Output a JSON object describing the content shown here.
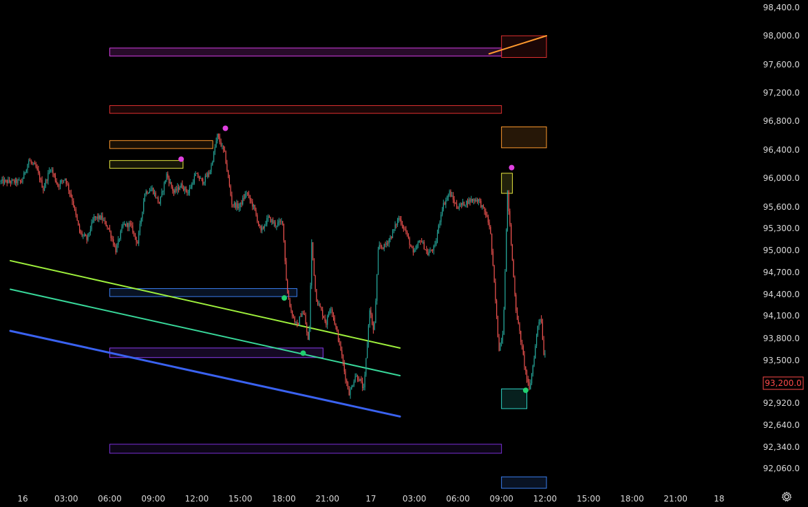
{
  "chart_data": {
    "type": "candlestick",
    "symbol": "",
    "title": "",
    "y_axis": {
      "ticks": [
        "98,400.0",
        "98,000.0",
        "97,600.0",
        "97,200.0",
        "96,800.0",
        "96,400.0",
        "96,000.0",
        "95,600.0",
        "95,300.0",
        "95,000.0",
        "94,700.0",
        "94,400.0",
        "94,100.0",
        "93,800.0",
        "93,500.0",
        "93,200.0",
        "92,920.0",
        "92,640.0",
        "92,340.0",
        "92,060.0"
      ],
      "ylim": [
        91800,
        98500
      ]
    },
    "x_axis": {
      "ticks": [
        "16",
        "03:00",
        "06:00",
        "09:00",
        "12:00",
        "15:00",
        "18:00",
        "21:00",
        "17",
        "03:00",
        "06:00",
        "09:00",
        "12:00",
        "15:00",
        "18:00",
        "21:00",
        "18"
      ]
    },
    "current_price": {
      "label": "93,200.0",
      "value": 93200,
      "color": "#ff4a4a"
    },
    "price_path": [
      [
        0.0,
        95950
      ],
      [
        0.5,
        96250
      ],
      [
        1.0,
        96150
      ],
      [
        1.5,
        95850
      ],
      [
        2.0,
        96150
      ],
      [
        2.5,
        95900
      ],
      [
        3.0,
        96000
      ],
      [
        3.5,
        95700
      ],
      [
        4.0,
        95250
      ],
      [
        4.5,
        95150
      ],
      [
        5.0,
        95450
      ],
      [
        5.5,
        95450
      ],
      [
        6.0,
        95300
      ],
      [
        6.5,
        95000
      ],
      [
        7.0,
        95350
      ],
      [
        7.5,
        95350
      ],
      [
        8.0,
        95100
      ],
      [
        8.5,
        95800
      ],
      [
        9.0,
        95850
      ],
      [
        9.5,
        95650
      ],
      [
        10.0,
        96050
      ],
      [
        10.5,
        95800
      ],
      [
        11.0,
        95900
      ],
      [
        11.5,
        95800
      ],
      [
        12.0,
        96050
      ],
      [
        12.5,
        95950
      ],
      [
        13.0,
        96100
      ],
      [
        13.5,
        96600
      ],
      [
        14.0,
        96350
      ],
      [
        14.5,
        95650
      ],
      [
        15.0,
        95600
      ],
      [
        15.5,
        95800
      ],
      [
        16.0,
        95600
      ],
      [
        16.5,
        95250
      ],
      [
        17.0,
        95450
      ],
      [
        17.5,
        95350
      ],
      [
        18.0,
        95400
      ],
      [
        18.3,
        94450
      ],
      [
        18.6,
        94150
      ],
      [
        19.0,
        93950
      ],
      [
        19.3,
        94150
      ],
      [
        19.5,
        94100
      ],
      [
        19.8,
        93700
      ],
      [
        20.0,
        95100
      ],
      [
        20.3,
        94350
      ],
      [
        20.6,
        94200
      ],
      [
        21.0,
        94000
      ],
      [
        21.3,
        94250
      ],
      [
        21.6,
        94000
      ],
      [
        22.0,
        93650
      ],
      [
        22.3,
        93300
      ],
      [
        22.6,
        93050
      ],
      [
        23.0,
        93300
      ],
      [
        23.3,
        93250
      ],
      [
        23.6,
        93100
      ],
      [
        24.0,
        94200
      ],
      [
        24.3,
        93850
      ],
      [
        24.6,
        95050
      ],
      [
        25.0,
        95050
      ],
      [
        25.5,
        95200
      ],
      [
        26.0,
        95450
      ],
      [
        26.5,
        95250
      ],
      [
        27.0,
        94950
      ],
      [
        27.5,
        95150
      ],
      [
        28.0,
        94950
      ],
      [
        28.5,
        95050
      ],
      [
        29.0,
        95600
      ],
      [
        29.5,
        95800
      ],
      [
        30.0,
        95600
      ],
      [
        30.5,
        95650
      ],
      [
        31.0,
        95700
      ],
      [
        31.5,
        95700
      ],
      [
        32.0,
        95500
      ],
      [
        32.3,
        95300
      ],
      [
        32.6,
        94500
      ],
      [
        32.9,
        93650
      ],
      [
        33.2,
        93900
      ],
      [
        33.5,
        95800
      ],
      [
        33.8,
        94950
      ],
      [
        34.1,
        94150
      ],
      [
        34.4,
        93800
      ],
      [
        34.7,
        93400
      ],
      [
        35.0,
        93100
      ],
      [
        35.3,
        93500
      ],
      [
        35.6,
        94000
      ],
      [
        35.8,
        94100
      ],
      [
        36.0,
        93600
      ]
    ],
    "boxes": [
      {
        "name": "magenta-zone",
        "x0": 6,
        "x1": 33,
        "y_hi": 97830,
        "y_lo": 97720,
        "stroke": "#d63fe6",
        "fill": "rgba(214,63,230,0.18)"
      },
      {
        "name": "red-zone-upper",
        "x0": 6,
        "x1": 33,
        "y_hi": 97020,
        "y_lo": 96910,
        "stroke": "#e03030",
        "fill": "rgba(224,48,48,0.12)"
      },
      {
        "name": "orange-zone",
        "x0": 6,
        "x1": 13.1,
        "y_hi": 96530,
        "y_lo": 96420,
        "stroke": "#ff9a2e",
        "fill": "rgba(255,154,46,0.10)"
      },
      {
        "name": "yellow-zone",
        "x0": 6,
        "x1": 11.05,
        "y_hi": 96250,
        "y_lo": 96140,
        "stroke": "#e6e640",
        "fill": "rgba(230,230,64,0.10)"
      },
      {
        "name": "blue-zone",
        "x0": 6,
        "x1": 18.9,
        "y_hi": 94480,
        "y_lo": 94370,
        "stroke": "#3a7ef0",
        "fill": "rgba(58,126,240,0.15)"
      },
      {
        "name": "purple-zone-mid",
        "x0": 6,
        "x1": 20.7,
        "y_hi": 93670,
        "y_lo": 93540,
        "stroke": "#8a3cf0",
        "fill": "rgba(138,60,240,0.15)"
      },
      {
        "name": "purple-zone-low",
        "x0": 6,
        "x1": 33,
        "y_hi": 92380,
        "y_lo": 92260,
        "stroke": "#7a30d8",
        "fill": "rgba(122,48,216,0.10)"
      },
      {
        "name": "red-zone-right",
        "x0": 33,
        "x1": 36.1,
        "y_hi": 98000,
        "y_lo": 97700,
        "stroke": "#e03030",
        "fill": "rgba(224,48,48,0.12)"
      },
      {
        "name": "orange-zone-right",
        "x0": 33,
        "x1": 36.1,
        "y_hi": 96720,
        "y_lo": 96430,
        "stroke": "#ff9a2e",
        "fill": "rgba(255,154,46,0.15)"
      },
      {
        "name": "yellow-zone-right",
        "x0": 33,
        "x1": 33.75,
        "y_hi": 96070,
        "y_lo": 95790,
        "stroke": "#e6e640",
        "fill": "rgba(230,230,64,0.15)"
      },
      {
        "name": "teal-zone-right",
        "x0": 33,
        "x1": 34.75,
        "y_hi": 93120,
        "y_lo": 92850,
        "stroke": "#30d8c8",
        "fill": "rgba(48,216,200,0.15)"
      },
      {
        "name": "blue-zone-right",
        "x0": 33,
        "x1": 36.1,
        "y_hi": 91950,
        "y_lo": 91800,
        "stroke": "#3a7ef0",
        "fill": "rgba(58,126,240,0.15)"
      }
    ],
    "trendlines": [
      {
        "name": "green-trendline",
        "x0": 0,
        "y0": 94860,
        "x1": 26,
        "y1": 93670,
        "color": "#9ef03c",
        "width": 2
      },
      {
        "name": "teal-trendline",
        "x0": 0,
        "y0": 94470,
        "x1": 26,
        "y1": 93300,
        "color": "#38d89a",
        "width": 2
      },
      {
        "name": "blue-trendline",
        "x0": 0,
        "y0": 93900,
        "x1": 26,
        "y1": 92750,
        "color": "#3a62f0",
        "width": 3
      },
      {
        "name": "orange-trendline",
        "x0": 33,
        "y0": 97750,
        "x1": 36.1,
        "y1": 98000,
        "color": "#ff9a2e",
        "width": 2
      }
    ],
    "markers": [
      {
        "name": "pivot-high-marker",
        "x": 10.92,
        "y": 96270,
        "color": "#e040e0"
      },
      {
        "name": "pivot-high-marker",
        "x": 13.97,
        "y": 96700,
        "color": "#e040e0"
      },
      {
        "name": "pivot-low-marker",
        "x": 18.03,
        "y": 94350,
        "color": "#20d070"
      },
      {
        "name": "pivot-low-marker",
        "x": 19.33,
        "y": 93600,
        "color": "#20d070"
      },
      {
        "name": "pivot-high-marker",
        "x": 33.7,
        "y": 96150,
        "color": "#e040e0"
      },
      {
        "name": "pivot-low-marker",
        "x": 34.67,
        "y": 93100,
        "color": "#20d070"
      }
    ],
    "colors": {
      "up": "#26a69a",
      "down": "#ef5350",
      "background": "#000000",
      "axis_text": "#d8d8d8"
    }
  },
  "icons": {
    "settings": "gear-icon"
  }
}
